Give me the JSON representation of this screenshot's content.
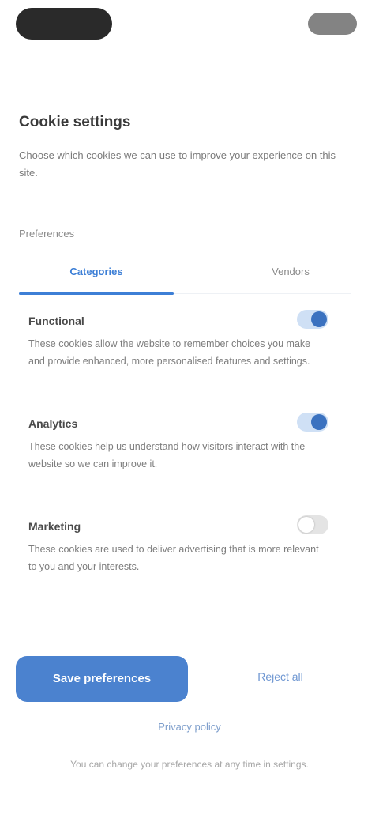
{
  "status_bar": {
    "left_pill": "",
    "right_pill": ""
  },
  "header": {
    "title": "Cookie settings",
    "description": "Choose which cookies we can use to improve your experience on this site."
  },
  "section": {
    "label": "Preferences"
  },
  "tabs": [
    {
      "label": "Categories",
      "active": true
    },
    {
      "label": "Vendors",
      "active": false
    }
  ],
  "preferences": [
    {
      "title": "Functional",
      "description": "These cookies allow the website to remember choices you make and provide enhanced, more personalised features and settings.",
      "enabled": true
    },
    {
      "title": "Analytics",
      "description": "These cookies help us understand how visitors interact with the website so we can improve it.",
      "enabled": true
    },
    {
      "title": "Marketing",
      "description": "These cookies are used to deliver advertising that is more relevant to you and your interests.",
      "enabled": false
    }
  ],
  "actions": {
    "primary": "Save preferences",
    "secondary": "Reject all",
    "footer_link": "Privacy policy",
    "footer_note": "You can change your preferences at any time in settings."
  },
  "colors": {
    "accent": "#3d7fd6",
    "primary_button": "#4b82cf",
    "toggle_on": "#3b72c0"
  }
}
